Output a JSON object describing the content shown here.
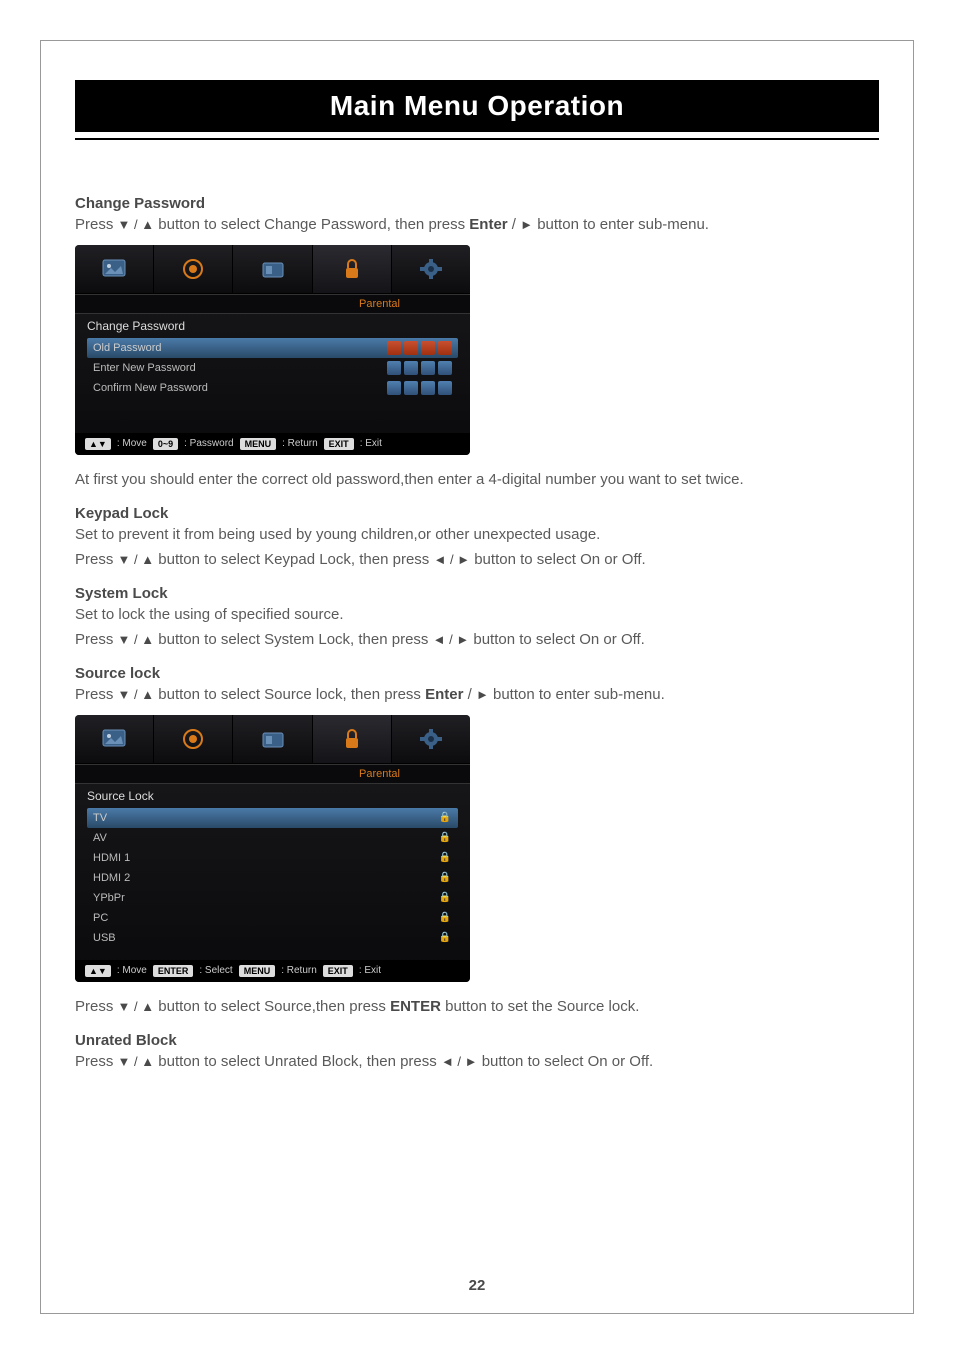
{
  "page": {
    "title": "Main Menu Operation",
    "number": "22"
  },
  "sections": {
    "changePassword": {
      "heading": "Change Password",
      "line1_a": "Press ",
      "line1_b": " button to select Change Password,  then press ",
      "line1_enter": "Enter",
      "line1_c": " / ",
      "line1_d": "button to enter sub-menu.",
      "after": "At first you should enter the correct old password,then enter a 4-digital number you want to set twice."
    },
    "keypadLock": {
      "heading": "Keypad Lock",
      "desc": "Set to prevent it from being used by young children,or other unexpected usage.",
      "press_a": "Press ",
      "press_b": " button to select Keypad Lock, then press ",
      "press_c": " button to select On or Off."
    },
    "systemLock": {
      "heading": "System Lock",
      "desc": "Set to lock the using of specified source.",
      "press_a": "Press ",
      "press_b": " button to select System Lock, then press ",
      "press_c": " button to select On or Off."
    },
    "sourceLock": {
      "heading": "Source lock",
      "line1_a": "Press ",
      "line1_b": " button to select Source lock,  then press ",
      "line1_enter": "Enter",
      "line1_c": " / ",
      "line1_d": "button to enter sub-menu.",
      "after_a": "Press ",
      "after_b": " button to select Source,then press ",
      "after_enter": "ENTER",
      "after_c": " button to set the Source lock."
    },
    "unratedBlock": {
      "heading": "Unrated Block",
      "press_a": "Press ",
      "press_b": " button to select Unrated Block, then press ",
      "press_c": " button to select On or Off."
    }
  },
  "osd1": {
    "tabLabel": "Parental",
    "sectionLabel": "Change Password",
    "rows": {
      "old": "Old Password",
      "enter": "Enter New Password",
      "confirm": "Confirm New Password"
    },
    "footer": {
      "move": ": Move",
      "numKeys": "0~9",
      "password": ": Password",
      "menu": "MENU",
      "return": ": Return",
      "exit": "EXIT",
      "exitLabel": ": Exit"
    }
  },
  "osd2": {
    "tabLabel": "Parental",
    "sectionLabel": "Source Lock",
    "rows": [
      "TV",
      "AV",
      "HDMI 1",
      "HDMI 2",
      "YPbPr",
      "PC",
      "USB"
    ],
    "footer": {
      "move": ": Move",
      "enter": "ENTER",
      "select": ": Select",
      "menu": "MENU",
      "return": ": Return",
      "exit": "EXIT",
      "exitLabel": ": Exit"
    }
  },
  "arrows": {
    "down": "▼",
    "up": "▲",
    "left": "◄",
    "right": "►",
    "sep": " / "
  }
}
